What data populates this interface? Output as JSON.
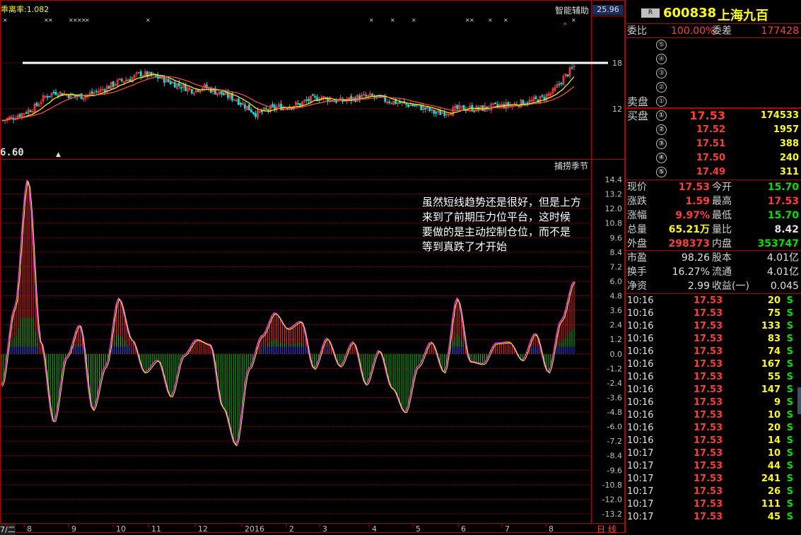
{
  "top_chart": {
    "indicator_label": "乖离率:1.082",
    "assist_label": "智能辅助",
    "price_box": "25.96",
    "low_price": "6.60",
    "y_labels": [
      "18",
      "12"
    ]
  },
  "sub_chart": {
    "title": "捕捞季节",
    "y_labels": [
      "14.4",
      "13.2",
      "12.0",
      "10.8",
      "9.6",
      "8.4",
      "7.2",
      "6.0",
      "4.8",
      "3.6",
      "2.4",
      "1.2",
      "0.0",
      "-1.2",
      "-2.4",
      "-3.6",
      "-4.8",
      "-6.0",
      "-7.2",
      "-8.4",
      "-9.6",
      "-10.8",
      "-12.0",
      "-13.2"
    ]
  },
  "note": {
    "line1": "虽然短线趋势还是很好，但是上方",
    "line2": "来到了前期压力位平台，这时候",
    "line3": "要做的是主动控制仓位，而不是",
    "line4": "等到真跌了才开始"
  },
  "x_axis": {
    "left_tab": "7/二",
    "labels": [
      "8",
      "9",
      "10",
      "11",
      "12",
      "2016",
      "2",
      "3",
      "4",
      "5",
      "6",
      "7",
      "8"
    ],
    "period": "日线"
  },
  "quote": {
    "badge": "R",
    "code": "600838",
    "name": "上海九百",
    "weibi_label": "委比",
    "weibi_value": "100.00%",
    "weicha_label": "委差",
    "weicha_value": "177428",
    "sell_label": "卖盘",
    "buy_label": "买盘",
    "sell_levels": [
      "⑤",
      "④",
      "③",
      "②",
      "①"
    ],
    "buy_levels": [
      {
        "no": "①",
        "price": "17.53",
        "vol": "174533"
      },
      {
        "no": "②",
        "price": "17.52",
        "vol": "1957"
      },
      {
        "no": "③",
        "price": "17.51",
        "vol": "388"
      },
      {
        "no": "④",
        "price": "17.50",
        "vol": "240"
      },
      {
        "no": "⑤",
        "price": "17.49",
        "vol": "311"
      }
    ],
    "stats": [
      {
        "l1": "现价",
        "v1": "17.53",
        "l2": "今开",
        "v2": "15.70",
        "c1": "red",
        "c2": "grn"
      },
      {
        "l1": "涨跌",
        "v1": "1.59",
        "l2": "最高",
        "v2": "17.53",
        "c1": "red",
        "c2": "red"
      },
      {
        "l1": "涨幅",
        "v1": "9.97%",
        "l2": "最低",
        "v2": "15.70",
        "c1": "red",
        "c2": "grn"
      },
      {
        "l1": "总量",
        "v1": "65.21万",
        "l2": "量比",
        "v2": "8.42",
        "c1": "yel",
        "c2": "wht"
      },
      {
        "l1": "外盘",
        "v1": "298373",
        "l2": "内盘",
        "v2": "353747",
        "c1": "red",
        "c2": "grn"
      }
    ],
    "stats2": [
      {
        "l1": "市盈",
        "v1": "98.26",
        "l2": "股本",
        "v2": "4.01亿"
      },
      {
        "l1": "换手",
        "v1": "16.27%",
        "l2": "流通",
        "v2": "4.01亿"
      },
      {
        "l1": "净资",
        "v1": "2.99",
        "l2": "收益(一)",
        "v2": "0.045"
      }
    ],
    "ticks": [
      {
        "t": "10:16",
        "p": "17.53",
        "v": "20",
        "s": "S"
      },
      {
        "t": "10:16",
        "p": "17.53",
        "v": "75",
        "s": "S"
      },
      {
        "t": "10:16",
        "p": "17.53",
        "v": "133",
        "s": "S"
      },
      {
        "t": "10:16",
        "p": "17.53",
        "v": "83",
        "s": "S"
      },
      {
        "t": "10:16",
        "p": "17.53",
        "v": "74",
        "s": "S"
      },
      {
        "t": "10:16",
        "p": "17.53",
        "v": "167",
        "s": "S"
      },
      {
        "t": "10:16",
        "p": "17.53",
        "v": "55",
        "s": "S"
      },
      {
        "t": "10:16",
        "p": "17.53",
        "v": "147",
        "s": "S"
      },
      {
        "t": "10:16",
        "p": "17.53",
        "v": "9",
        "s": "S"
      },
      {
        "t": "10:16",
        "p": "17.53",
        "v": "10",
        "s": "S"
      },
      {
        "t": "10:16",
        "p": "17.53",
        "v": "20",
        "s": "S"
      },
      {
        "t": "10:16",
        "p": "17.53",
        "v": "14",
        "s": "S"
      },
      {
        "t": "10:17",
        "p": "17.53",
        "v": "10",
        "s": "S"
      },
      {
        "t": "10:17",
        "p": "17.53",
        "v": "44",
        "s": "S"
      },
      {
        "t": "10:17",
        "p": "17.53",
        "v": "241",
        "s": "S"
      },
      {
        "t": "10:17",
        "p": "17.53",
        "v": "26",
        "s": "S"
      },
      {
        "t": "10:17",
        "p": "17.53",
        "v": "111",
        "s": "S"
      },
      {
        "t": "10:17",
        "p": "17.53",
        "v": "45",
        "s": "S"
      }
    ]
  },
  "colors": {
    "up": "#ff3c3c",
    "down": "#00e0e0",
    "grid": "#b00000",
    "ma_yellow": "#ffff00",
    "ma_red": "#ff5050",
    "hist_red": "#ff2020",
    "hist_green": "#00c000",
    "osc_line": "#ff40ff"
  },
  "chart_data": {
    "type": "line",
    "series": [
      {
        "values": [
          10.5,
          10.9,
          11.5,
          12.2,
          13.6,
          14.2,
          13.9,
          13.6,
          13.8,
          14.3,
          14.9,
          15.6,
          15.9,
          16.6,
          16.3,
          16.0,
          15.4,
          14.9,
          14.4,
          14.9,
          14.3,
          13.8,
          13.3,
          12.3,
          11.3,
          11.9,
          12.2,
          12.4,
          12.6,
          13.2,
          13.5,
          13.2,
          13.0,
          13.3,
          13.6,
          13.6,
          13.2,
          12.9,
          12.6,
          12.4,
          12.0,
          11.4,
          11.6,
          12.0,
          12.1,
          12.0,
          12.2,
          12.4,
          12.5,
          12.8,
          13.0,
          13.4,
          14.2,
          16.0,
          17.53
        ]
      },
      {
        "values": [
          -2.6,
          3.8,
          14.4,
          1.0,
          -5.6,
          -0.2,
          2.4,
          -4.6,
          -1.0,
          4.6,
          1.2,
          -1.5,
          -0.5,
          -3.5,
          -0.1,
          1.2,
          0.8,
          -4.4,
          -7.5,
          -1.2,
          1.5,
          3.4,
          2.1,
          2.7,
          -1.2,
          1.3,
          -1.0,
          1.0,
          -2.5,
          0.3,
          -2.8,
          -4.8,
          -1.0,
          1.0,
          -1.5,
          4.6,
          -0.6,
          -0.8,
          0.9,
          1.0,
          -0.5,
          1.7,
          -1.5,
          2.8,
          6.0
        ]
      }
    ],
    "ylim_sub": [
      -13.2,
      14.4
    ],
    "resistance": 18
  }
}
